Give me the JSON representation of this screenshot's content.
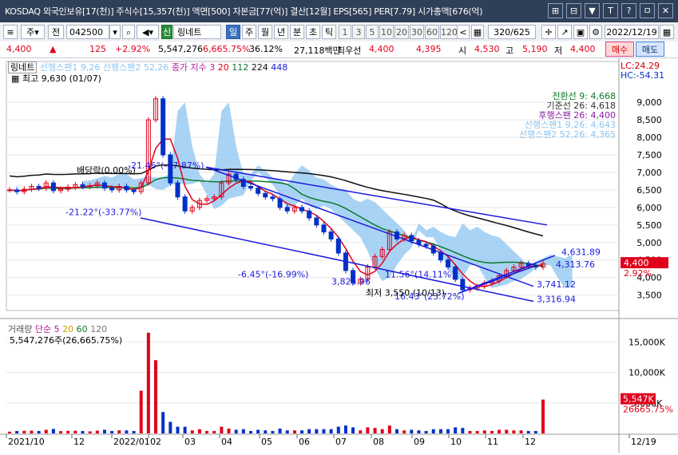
{
  "titlebar": {
    "text": "KOSDAQ 외국인보유[17(천)] 주식수[15,357(천)] 액면[500] 자본금[77(억)] 결산[12월] EPS[565] PER[7.79] 시가총액[676(억)",
    "icons": [
      "link-icon",
      "share-icon",
      "minimize-icon",
      "pin-icon",
      "help-icon",
      "restore-icon",
      "close-icon"
    ],
    "icon_glyphs": [
      "⊞",
      "⊟",
      "▼",
      "T",
      "?",
      "ㅁ",
      "✕"
    ]
  },
  "toolbar": {
    "market": "주",
    "period_btn": "전",
    "code": "042500",
    "stock_tag": "신",
    "stock_name": "링네트",
    "periods": [
      "일",
      "주",
      "월",
      "년",
      "분",
      "초",
      "틱"
    ],
    "selected_period": "일",
    "intervals": [
      "1",
      "3",
      "5",
      "10",
      "20",
      "30",
      "60",
      "120"
    ],
    "count": "320",
    "total": "/625",
    "date": "2022/12/19"
  },
  "quote": {
    "price": "4,400",
    "change_arrow": "▲",
    "change": "125",
    "change_pct": "+2.92%",
    "volume": "5,547,276",
    "volume_pct": "6,665.75%",
    "ratio": "36.12%",
    "amount": "27,118백만",
    "pref_label": "최우선",
    "pref_ask": "4,400",
    "pref_bid": "4,395",
    "open_label": "시",
    "open": "4,530",
    "high_label": "고",
    "high": "5,190",
    "low_label": "저",
    "low": "4,400",
    "buy": "매수",
    "sell": "매도"
  },
  "legend_top": {
    "name": "링네트",
    "senkou1": "선행스팬1 9,26",
    "senkou2": "선행스팬2 52,26",
    "close_ma": "종가 지수 3",
    "ma20": "20",
    "ma112": "112",
    "ma224": "224",
    "ma448": "448",
    "lc": "LC:24.29",
    "hc": "HC:-54.31",
    "high_marker": "최고 9,630 (01/07)",
    "ichimoku": [
      {
        "label": "전환선 9: 4,668",
        "color": "#0a7a2a"
      },
      {
        "label": "기준선 26: 4,618",
        "color": "#333333"
      },
      {
        "label": "후행스팬 26: 4,400",
        "color": "#8a1aa0"
      },
      {
        "label": "선행스팬1 9,26: 4,643",
        "color": "#8cc4f0"
      },
      {
        "label": "선행스팬2 52,26: 4,365",
        "color": "#8cc4f0"
      }
    ]
  },
  "annotations": {
    "mdd": "배당락(0.00%)",
    "t1": "-21.46°(-47.87%)",
    "t2": "-21.22°(-33.77%)",
    "t3": "-6.45°(-16.99%)",
    "t4": "11.56°(14.11%)",
    "t5": "16.43°(23.72%)",
    "low_mark": "최저 3,550 (10/13)",
    "v1": "3,825.96",
    "v2": "4,631.89",
    "v3": "4,313.76",
    "v4": "3,741.12",
    "v5": "3,316.94",
    "cur_price_tag": "4,400",
    "cur_pct_tag": "2.92%"
  },
  "price_axis": [
    "9,000",
    "8,500",
    "8,000",
    "7,500",
    "7,000",
    "6,500",
    "6,000",
    "5,500",
    "5,000",
    "4,500",
    "4,000",
    "3,500"
  ],
  "volume_legend": {
    "name": "거래량",
    "ma_label": "단순",
    "ma5": "5",
    "ma20": "20",
    "ma60": "60",
    "ma120": "120",
    "value": "5,547,276주(26,665.75%)",
    "tag": "5,547K",
    "tag_pct": "26665.75%"
  },
  "volume_axis": [
    "15,000K",
    "10,000K",
    "5,000K"
  ],
  "date_axis": [
    "2021/10",
    "12",
    "2022/01",
    "02",
    "03",
    "04",
    "05",
    "06",
    "07",
    "08",
    "09",
    "10",
    "11",
    "12",
    "12/19"
  ],
  "colors": {
    "up": "#e0001b",
    "down": "#0030c8",
    "ma20": "#e0001b",
    "ma112": "#0a7a2a",
    "ma224": "#111111",
    "cloud": "#8cc4f0",
    "trend": "#1a1adb"
  },
  "price_series": [
    6500,
    6450,
    6520,
    6600,
    6550,
    6700,
    6480,
    6520,
    6580,
    6650,
    6600,
    6620,
    6700,
    6550,
    6500,
    6600,
    6500,
    6450,
    6700,
    8500,
    9100,
    7500,
    6700,
    6300,
    5900,
    6000,
    6200,
    6250,
    6300,
    6700,
    6950,
    6800,
    6600,
    6550,
    6400,
    6300,
    6250,
    6000,
    5900,
    6000,
    5900,
    5700,
    5500,
    5300,
    5100,
    4700,
    4200,
    3850,
    3950,
    4300,
    4600,
    4800,
    5300,
    5100,
    5200,
    5050,
    4950,
    4900,
    4700,
    4500,
    4300,
    3950,
    3650,
    3700,
    3750,
    3850,
    3900,
    4050,
    4200,
    4300,
    4400,
    4350,
    4300,
    4400
  ]
}
